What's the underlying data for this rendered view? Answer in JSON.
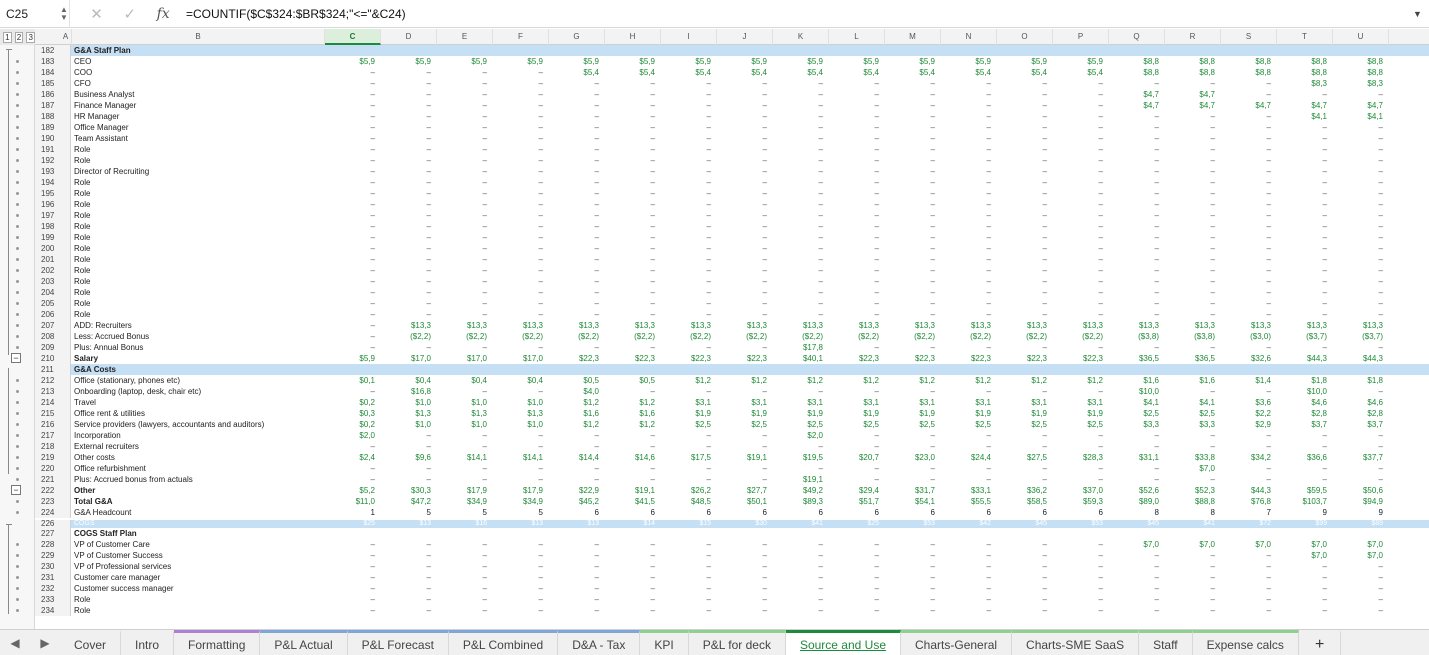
{
  "formula_bar": {
    "name_box": "C25",
    "formula": "=COUNTIF($C$324:$BR$324;\"<=\"&C24)",
    "fx": "fx"
  },
  "levels": [
    "1",
    "2",
    "3"
  ],
  "columns": [
    "A",
    "B",
    "C",
    "D",
    "E",
    "F",
    "G",
    "H",
    "I",
    "J",
    "K",
    "L",
    "M",
    "N",
    "O",
    "P",
    "Q",
    "R",
    "S",
    "T",
    "U"
  ],
  "rows": [
    {
      "n": "182",
      "label": "G&A Staff Plan",
      "style": "sec",
      "cells": []
    },
    {
      "n": "183",
      "label": "CEO",
      "cells": [
        "$5,9",
        "$5,9",
        "$5,9",
        "$5,9",
        "$5,9",
        "$5,9",
        "$5,9",
        "$5,9",
        "$5,9",
        "$5,9",
        "$5,9",
        "$5,9",
        "$5,9",
        "$5,9",
        "$8,8",
        "$8,8",
        "$8,8",
        "$8,8",
        "$8,8"
      ]
    },
    {
      "n": "184",
      "label": "COO",
      "cells": [
        "–",
        "–",
        "–",
        "–",
        "$5,4",
        "$5,4",
        "$5,4",
        "$5,4",
        "$5,4",
        "$5,4",
        "$5,4",
        "$5,4",
        "$5,4",
        "$5,4",
        "$8,8",
        "$8,8",
        "$8,8",
        "$8,8",
        "$8,8"
      ]
    },
    {
      "n": "185",
      "label": "CFO",
      "cells": [
        "–",
        "–",
        "–",
        "–",
        "–",
        "–",
        "–",
        "–",
        "–",
        "–",
        "–",
        "–",
        "–",
        "–",
        "–",
        "–",
        "–",
        "$8,3",
        "$8,3"
      ]
    },
    {
      "n": "186",
      "label": "Business Analyst",
      "cells": [
        "–",
        "–",
        "–",
        "–",
        "–",
        "–",
        "–",
        "–",
        "–",
        "–",
        "–",
        "–",
        "–",
        "–",
        "$4,7",
        "$4,7",
        "–",
        "–",
        "–"
      ]
    },
    {
      "n": "187",
      "label": "Finance Manager",
      "cells": [
        "–",
        "–",
        "–",
        "–",
        "–",
        "–",
        "–",
        "–",
        "–",
        "–",
        "–",
        "–",
        "–",
        "–",
        "$4,7",
        "$4,7",
        "$4,7",
        "$4,7",
        "$4,7"
      ]
    },
    {
      "n": "188",
      "label": "HR Manager",
      "cells": [
        "–",
        "–",
        "–",
        "–",
        "–",
        "–",
        "–",
        "–",
        "–",
        "–",
        "–",
        "–",
        "–",
        "–",
        "–",
        "–",
        "–",
        "$4,1",
        "$4,1"
      ]
    },
    {
      "n": "189",
      "label": "Office Manager",
      "cells": [
        "–",
        "–",
        "–",
        "–",
        "–",
        "–",
        "–",
        "–",
        "–",
        "–",
        "–",
        "–",
        "–",
        "–",
        "–",
        "–",
        "–",
        "–",
        "–"
      ]
    },
    {
      "n": "190",
      "label": "Team Assistant",
      "cells": [
        "–",
        "–",
        "–",
        "–",
        "–",
        "–",
        "–",
        "–",
        "–",
        "–",
        "–",
        "–",
        "–",
        "–",
        "–",
        "–",
        "–",
        "–",
        "–"
      ]
    },
    {
      "n": "191",
      "label": "Role",
      "cells": [
        "–",
        "–",
        "–",
        "–",
        "–",
        "–",
        "–",
        "–",
        "–",
        "–",
        "–",
        "–",
        "–",
        "–",
        "–",
        "–",
        "–",
        "–",
        "–"
      ]
    },
    {
      "n": "192",
      "label": "Role",
      "cells": [
        "–",
        "–",
        "–",
        "–",
        "–",
        "–",
        "–",
        "–",
        "–",
        "–",
        "–",
        "–",
        "–",
        "–",
        "–",
        "–",
        "–",
        "–",
        "–"
      ]
    },
    {
      "n": "193",
      "label": "Director of Recruiting",
      "cells": [
        "–",
        "–",
        "–",
        "–",
        "–",
        "–",
        "–",
        "–",
        "–",
        "–",
        "–",
        "–",
        "–",
        "–",
        "–",
        "–",
        "–",
        "–",
        "–"
      ]
    },
    {
      "n": "194",
      "label": "Role",
      "cells": [
        "–",
        "–",
        "–",
        "–",
        "–",
        "–",
        "–",
        "–",
        "–",
        "–",
        "–",
        "–",
        "–",
        "–",
        "–",
        "–",
        "–",
        "–",
        "–"
      ]
    },
    {
      "n": "195",
      "label": "Role",
      "cells": [
        "–",
        "–",
        "–",
        "–",
        "–",
        "–",
        "–",
        "–",
        "–",
        "–",
        "–",
        "–",
        "–",
        "–",
        "–",
        "–",
        "–",
        "–",
        "–"
      ]
    },
    {
      "n": "196",
      "label": "Role",
      "cells": [
        "–",
        "–",
        "–",
        "–",
        "–",
        "–",
        "–",
        "–",
        "–",
        "–",
        "–",
        "–",
        "–",
        "–",
        "–",
        "–",
        "–",
        "–",
        "–"
      ]
    },
    {
      "n": "197",
      "label": "Role",
      "cells": [
        "–",
        "–",
        "–",
        "–",
        "–",
        "–",
        "–",
        "–",
        "–",
        "–",
        "–",
        "–",
        "–",
        "–",
        "–",
        "–",
        "–",
        "–",
        "–"
      ]
    },
    {
      "n": "198",
      "label": "Role",
      "cells": [
        "–",
        "–",
        "–",
        "–",
        "–",
        "–",
        "–",
        "–",
        "–",
        "–",
        "–",
        "–",
        "–",
        "–",
        "–",
        "–",
        "–",
        "–",
        "–"
      ]
    },
    {
      "n": "199",
      "label": "Role",
      "cells": [
        "–",
        "–",
        "–",
        "–",
        "–",
        "–",
        "–",
        "–",
        "–",
        "–",
        "–",
        "–",
        "–",
        "–",
        "–",
        "–",
        "–",
        "–",
        "–"
      ]
    },
    {
      "n": "200",
      "label": "Role",
      "cells": [
        "–",
        "–",
        "–",
        "–",
        "–",
        "–",
        "–",
        "–",
        "–",
        "–",
        "–",
        "–",
        "–",
        "–",
        "–",
        "–",
        "–",
        "–",
        "–"
      ]
    },
    {
      "n": "201",
      "label": "Role",
      "cells": [
        "–",
        "–",
        "–",
        "–",
        "–",
        "–",
        "–",
        "–",
        "–",
        "–",
        "–",
        "–",
        "–",
        "–",
        "–",
        "–",
        "–",
        "–",
        "–"
      ]
    },
    {
      "n": "202",
      "label": "Role",
      "cells": [
        "–",
        "–",
        "–",
        "–",
        "–",
        "–",
        "–",
        "–",
        "–",
        "–",
        "–",
        "–",
        "–",
        "–",
        "–",
        "–",
        "–",
        "–",
        "–"
      ]
    },
    {
      "n": "203",
      "label": "Role",
      "cells": [
        "–",
        "–",
        "–",
        "–",
        "–",
        "–",
        "–",
        "–",
        "–",
        "–",
        "–",
        "–",
        "–",
        "–",
        "–",
        "–",
        "–",
        "–",
        "–"
      ]
    },
    {
      "n": "204",
      "label": "Role",
      "cells": [
        "–",
        "–",
        "–",
        "–",
        "–",
        "–",
        "–",
        "–",
        "–",
        "–",
        "–",
        "–",
        "–",
        "–",
        "–",
        "–",
        "–",
        "–",
        "–"
      ]
    },
    {
      "n": "205",
      "label": "Role",
      "cells": [
        "–",
        "–",
        "–",
        "–",
        "–",
        "–",
        "–",
        "–",
        "–",
        "–",
        "–",
        "–",
        "–",
        "–",
        "–",
        "–",
        "–",
        "–",
        "–"
      ]
    },
    {
      "n": "206",
      "label": "Role",
      "cells": [
        "–",
        "–",
        "–",
        "–",
        "–",
        "–",
        "–",
        "–",
        "–",
        "–",
        "–",
        "–",
        "–",
        "–",
        "–",
        "–",
        "–",
        "–",
        "–"
      ]
    },
    {
      "n": "207",
      "label": "ADD: Recruiters",
      "cells": [
        "–",
        "$13,3",
        "$13,3",
        "$13,3",
        "$13,3",
        "$13,3",
        "$13,3",
        "$13,3",
        "$13,3",
        "$13,3",
        "$13,3",
        "$13,3",
        "$13,3",
        "$13,3",
        "$13,3",
        "$13,3",
        "$13,3",
        "$13,3",
        "$13,3"
      ]
    },
    {
      "n": "208",
      "label": "Less: Accrued Bonus",
      "cells": [
        "–",
        "($2,2)",
        "($2,2)",
        "($2,2)",
        "($2,2)",
        "($2,2)",
        "($2,2)",
        "($2,2)",
        "($2,2)",
        "($2,2)",
        "($2,2)",
        "($2,2)",
        "($2,2)",
        "($2,2)",
        "($3,8)",
        "($3,8)",
        "($3,0)",
        "($3,7)",
        "($3,7)"
      ]
    },
    {
      "n": "209",
      "label": "Plus: Annual Bonus",
      "cells": [
        "–",
        "–",
        "–",
        "–",
        "–",
        "–",
        "–",
        "–",
        "$17,8",
        "–",
        "–",
        "–",
        "–",
        "–",
        "–",
        "–",
        "–",
        "–",
        "–"
      ]
    },
    {
      "n": "210",
      "label": "Salary",
      "style": "bold",
      "cells": [
        "$5,9",
        "$17,0",
        "$17,0",
        "$17,0",
        "$22,3",
        "$22,3",
        "$22,3",
        "$22,3",
        "$40,1",
        "$22,3",
        "$22,3",
        "$22,3",
        "$22,3",
        "$22,3",
        "$36,5",
        "$36,5",
        "$32,6",
        "$44,3",
        "$44,3"
      ]
    },
    {
      "n": "211",
      "label": "G&A Costs",
      "style": "sec",
      "cells": []
    },
    {
      "n": "212",
      "label": "Office (stationary, phones etc)",
      "cells": [
        "$0,1",
        "$0,4",
        "$0,4",
        "$0,4",
        "$0,5",
        "$0,5",
        "$1,2",
        "$1,2",
        "$1,2",
        "$1,2",
        "$1,2",
        "$1,2",
        "$1,2",
        "$1,2",
        "$1,6",
        "$1,6",
        "$1,4",
        "$1,8",
        "$1,8"
      ]
    },
    {
      "n": "213",
      "label": "Onboarding (laptop, desk, chair etc)",
      "cells": [
        "–",
        "$16,8",
        "–",
        "–",
        "$4,0",
        "–",
        "–",
        "–",
        "–",
        "–",
        "–",
        "–",
        "–",
        "–",
        "$10,0",
        "–",
        "–",
        "$10,0",
        "–"
      ]
    },
    {
      "n": "214",
      "label": "Travel",
      "cells": [
        "$0,2",
        "$1,0",
        "$1,0",
        "$1,0",
        "$1,2",
        "$1,2",
        "$3,1",
        "$3,1",
        "$3,1",
        "$3,1",
        "$3,1",
        "$3,1",
        "$3,1",
        "$3,1",
        "$4,1",
        "$4,1",
        "$3,6",
        "$4,6",
        "$4,6"
      ]
    },
    {
      "n": "215",
      "label": "Office rent & utilities",
      "cells": [
        "$0,3",
        "$1,3",
        "$1,3",
        "$1,3",
        "$1,6",
        "$1,6",
        "$1,9",
        "$1,9",
        "$1,9",
        "$1,9",
        "$1,9",
        "$1,9",
        "$1,9",
        "$1,9",
        "$2,5",
        "$2,5",
        "$2,2",
        "$2,8",
        "$2,8"
      ]
    },
    {
      "n": "216",
      "label": "Service providers (lawyers, accountants and auditors)",
      "cells": [
        "$0,2",
        "$1,0",
        "$1,0",
        "$1,0",
        "$1,2",
        "$1,2",
        "$2,5",
        "$2,5",
        "$2,5",
        "$2,5",
        "$2,5",
        "$2,5",
        "$2,5",
        "$2,5",
        "$3,3",
        "$3,3",
        "$2,9",
        "$3,7",
        "$3,7"
      ]
    },
    {
      "n": "217",
      "label": "Incorporation",
      "cells": [
        "$2,0",
        "–",
        "–",
        "–",
        "–",
        "–",
        "–",
        "–",
        "$2,0",
        "–",
        "–",
        "–",
        "–",
        "–",
        "–",
        "–",
        "–",
        "–",
        "–"
      ]
    },
    {
      "n": "218",
      "label": "External recruiters",
      "cells": [
        "–",
        "–",
        "–",
        "–",
        "–",
        "–",
        "–",
        "–",
        "–",
        "–",
        "–",
        "–",
        "–",
        "–",
        "–",
        "–",
        "–",
        "–",
        "–"
      ]
    },
    {
      "n": "219",
      "label": "Other costs",
      "cells": [
        "$2,4",
        "$9,6",
        "$14,1",
        "$14,1",
        "$14,4",
        "$14,6",
        "$17,5",
        "$19,1",
        "$19,5",
        "$20,7",
        "$23,0",
        "$24,4",
        "$27,5",
        "$28,3",
        "$31,1",
        "$33,8",
        "$34,2",
        "$36,6",
        "$37,7"
      ]
    },
    {
      "n": "220",
      "label": "Office refurbishment",
      "cells": [
        "–",
        "–",
        "–",
        "–",
        "–",
        "–",
        "–",
        "–",
        "–",
        "–",
        "–",
        "–",
        "–",
        "–",
        "–",
        "$7,0",
        "–",
        "–",
        "–"
      ]
    },
    {
      "n": "221",
      "label": "Plus: Accrued bonus from actuals",
      "cells": [
        "–",
        "–",
        "–",
        "–",
        "–",
        "–",
        "–",
        "–",
        "$19,1",
        "–",
        "–",
        "–",
        "–",
        "–",
        "–",
        "–",
        "–",
        "–",
        "–"
      ]
    },
    {
      "n": "222",
      "label": "Other",
      "style": "bold",
      "cells": [
        "$5,2",
        "$30,3",
        "$17,9",
        "$17,9",
        "$22,9",
        "$19,1",
        "$26,2",
        "$27,7",
        "$49,2",
        "$29,4",
        "$31,7",
        "$33,1",
        "$36,2",
        "$37,0",
        "$52,6",
        "$52,3",
        "$44,3",
        "$59,5",
        "$50,6"
      ]
    },
    {
      "n": "223",
      "label": "Total G&A",
      "style": "bold",
      "cells": [
        "$11,0",
        "$47,2",
        "$34,9",
        "$34,9",
        "$45,2",
        "$41,5",
        "$48,5",
        "$50,1",
        "$89,3",
        "$51,7",
        "$54,1",
        "$55,5",
        "$58,5",
        "$59,3",
        "$89,0",
        "$88,8",
        "$76,8",
        "$103,7",
        "$94,9"
      ]
    },
    {
      "n": "224",
      "label": "G&A Headcount",
      "cells": [
        "1",
        "5",
        "5",
        "5",
        "6",
        "6",
        "6",
        "6",
        "6",
        "6",
        "6",
        "6",
        "6",
        "6",
        "8",
        "8",
        "7",
        "9",
        "9"
      ]
    },
    {
      "n": "226",
      "label": "COGS",
      "style": "gap",
      "cells": [
        "$25",
        "$13",
        "$16",
        "$13",
        "$13",
        "$14",
        "$15",
        "$30",
        "$41",
        "$25",
        "$53",
        "$42",
        "$45",
        "$53",
        "$45",
        "$41",
        "$72",
        "$99",
        "$89"
      ]
    },
    {
      "n": "227",
      "label": "COGS Staff Plan",
      "style": "bold",
      "cells": []
    },
    {
      "n": "228",
      "label": "VP of Customer Care",
      "cells": [
        "–",
        "–",
        "–",
        "–",
        "–",
        "–",
        "–",
        "–",
        "–",
        "–",
        "–",
        "–",
        "–",
        "–",
        "$7,0",
        "$7,0",
        "$7,0",
        "$7,0",
        "$7,0"
      ]
    },
    {
      "n": "229",
      "label": "VP of Customer Success",
      "cells": [
        "–",
        "–",
        "–",
        "–",
        "–",
        "–",
        "–",
        "–",
        "–",
        "–",
        "–",
        "–",
        "–",
        "–",
        "–",
        "–",
        "–",
        "$7,0",
        "$7,0"
      ]
    },
    {
      "n": "230",
      "label": "VP of Professional services",
      "cells": [
        "–",
        "–",
        "–",
        "–",
        "–",
        "–",
        "–",
        "–",
        "–",
        "–",
        "–",
        "–",
        "–",
        "–",
        "–",
        "–",
        "–",
        "–",
        "–"
      ]
    },
    {
      "n": "231",
      "label": "Customer care manager",
      "cells": [
        "–",
        "–",
        "–",
        "–",
        "–",
        "–",
        "–",
        "–",
        "–",
        "–",
        "–",
        "–",
        "–",
        "–",
        "–",
        "–",
        "–",
        "–",
        "–"
      ]
    },
    {
      "n": "232",
      "label": "Customer success manager",
      "cells": [
        "–",
        "–",
        "–",
        "–",
        "–",
        "–",
        "–",
        "–",
        "–",
        "–",
        "–",
        "–",
        "–",
        "–",
        "–",
        "–",
        "–",
        "–",
        "–"
      ]
    },
    {
      "n": "233",
      "label": "Role",
      "cells": [
        "–",
        "–",
        "–",
        "–",
        "–",
        "–",
        "–",
        "–",
        "–",
        "–",
        "–",
        "–",
        "–",
        "–",
        "–",
        "–",
        "–",
        "–",
        "–"
      ]
    },
    {
      "n": "234",
      "label": "Role",
      "cells": [
        "–",
        "–",
        "–",
        "–",
        "–",
        "–",
        "–",
        "–",
        "–",
        "–",
        "–",
        "–",
        "–",
        "–",
        "–",
        "–",
        "–",
        "–",
        "–"
      ]
    }
  ],
  "tabs": [
    "Cover",
    "Intro",
    "Formatting",
    "P&L Actual",
    "P&L Forecast",
    "P&L Combined",
    "D&A - Tax",
    "KPI",
    "P&L for deck",
    "Source and Use",
    "Charts-General",
    "Charts-SME SaaS",
    "Staff",
    "Expense calcs"
  ],
  "active_tab": "Source and Use",
  "add_tab": "+",
  "colors": {
    "accent": "#1e8a3c",
    "section": "#c5dff4",
    "value": "#1f8a38"
  }
}
